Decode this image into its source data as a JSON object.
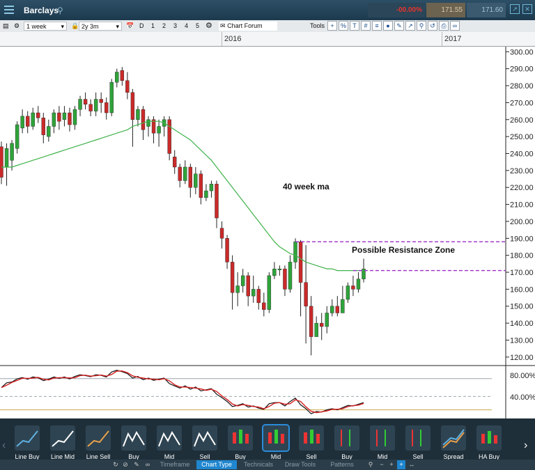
{
  "window": {
    "title": "Barclays",
    "change": "-00.00%",
    "sell_price": "171.55",
    "buy_price": "171.60"
  },
  "toolbar": {
    "interval": "1 week",
    "range": "2y 3m",
    "day_buttons": [
      "D",
      "1",
      "2",
      "3",
      "4",
      "5"
    ],
    "forum_label": "Chart Forum",
    "tools_label": "Tools",
    "tool_icons": [
      "crosshair-icon",
      "percent-icon",
      "text-icon",
      "grid-icon",
      "fibonacci-icon",
      "bulb-icon",
      "pencil-icon",
      "arrow-icon",
      "pin-icon",
      "loop-icon",
      "printer-icon",
      "link-icon"
    ]
  },
  "years": [
    "2016",
    "2017"
  ],
  "price_axis": [
    "300.00",
    "290.00",
    "280.00",
    "270.00",
    "260.00",
    "250.00",
    "240.00",
    "230.00",
    "220.00",
    "210.00",
    "200.00",
    "190.00",
    "180.00",
    "170.00",
    "160.00",
    "150.00",
    "140.00",
    "130.00",
    "120.00"
  ],
  "annotations": {
    "ma_label": "40 week ma",
    "resistance_label": "Possible Resistance Zone"
  },
  "indicator_axis": [
    "80.00%",
    "40.00%"
  ],
  "chart_data": {
    "type": "candlestick",
    "title": "",
    "ylim": [
      115,
      303
    ],
    "resistance_zone": [
      188,
      171
    ],
    "candles": [
      [
        244,
        226,
        247,
        222
      ],
      [
        232,
        243,
        246,
        221
      ],
      [
        236,
        246,
        248,
        230
      ],
      [
        243,
        257,
        259,
        240
      ],
      [
        255,
        262,
        266,
        252
      ],
      [
        262,
        256,
        265,
        252
      ],
      [
        256,
        264,
        267,
        254
      ],
      [
        264,
        261,
        268,
        258
      ],
      [
        261,
        251,
        264,
        246
      ],
      [
        250,
        256,
        260,
        247
      ],
      [
        256,
        264,
        266,
        252
      ],
      [
        264,
        259,
        268,
        254
      ],
      [
        260,
        264,
        268,
        256
      ],
      [
        264,
        257,
        267,
        253
      ],
      [
        257,
        266,
        268,
        254
      ],
      [
        266,
        272,
        274,
        262
      ],
      [
        272,
        269,
        276,
        266
      ],
      [
        269,
        265,
        272,
        262
      ],
      [
        265,
        272,
        276,
        262
      ],
      [
        272,
        270,
        276,
        264
      ],
      [
        270,
        264,
        273,
        260
      ],
      [
        264,
        282,
        284,
        262
      ],
      [
        282,
        288,
        290,
        279
      ],
      [
        289,
        283,
        291,
        280
      ],
      [
        283,
        276,
        288,
        272
      ],
      [
        276,
        260,
        278,
        244
      ],
      [
        260,
        266,
        268,
        256
      ],
      [
        266,
        254,
        268,
        248
      ],
      [
        256,
        260,
        262,
        250
      ],
      [
        260,
        252,
        262,
        246
      ],
      [
        252,
        256,
        260,
        244
      ],
      [
        256,
        260,
        262,
        250
      ],
      [
        260,
        240,
        262,
        236
      ],
      [
        238,
        232,
        242,
        228
      ],
      [
        232,
        224,
        234,
        220
      ],
      [
        224,
        232,
        236,
        222
      ],
      [
        232,
        220,
        234,
        214
      ],
      [
        220,
        228,
        232,
        216
      ],
      [
        228,
        214,
        230,
        210
      ],
      [
        214,
        218,
        222,
        212
      ],
      [
        218,
        222,
        224,
        214
      ],
      [
        222,
        202,
        224,
        196
      ],
      [
        196,
        190,
        200,
        184
      ],
      [
        190,
        176,
        192,
        172
      ],
      [
        176,
        158,
        180,
        148
      ],
      [
        158,
        162,
        170,
        150
      ],
      [
        162,
        168,
        172,
        158
      ],
      [
        168,
        156,
        170,
        150
      ],
      [
        156,
        160,
        168,
        152
      ],
      [
        160,
        152,
        162,
        148
      ],
      [
        152,
        148,
        158,
        144
      ],
      [
        148,
        168,
        170,
        146
      ],
      [
        168,
        172,
        176,
        166
      ],
      [
        172,
        172,
        174,
        168
      ],
      [
        172,
        160,
        174,
        156
      ],
      [
        160,
        176,
        180,
        158
      ],
      [
        176,
        188,
        190,
        172
      ],
      [
        188,
        164,
        189,
        144
      ],
      [
        164,
        150,
        186,
        128
      ],
      [
        150,
        132,
        156,
        121
      ],
      [
        132,
        140,
        144,
        134
      ],
      [
        140,
        138,
        146,
        130
      ],
      [
        138,
        146,
        150,
        134
      ],
      [
        146,
        150,
        154,
        144
      ],
      [
        150,
        146,
        156,
        144
      ],
      [
        146,
        154,
        162,
        146
      ],
      [
        154,
        162,
        164,
        152
      ],
      [
        162,
        160,
        168,
        156
      ],
      [
        160,
        166,
        170,
        158
      ],
      [
        166,
        172,
        178,
        164
      ]
    ],
    "ma": [
      232,
      232,
      232,
      233,
      234,
      235,
      236,
      237,
      238,
      239,
      240,
      241,
      242,
      243,
      244,
      245,
      246,
      247,
      248,
      249,
      250,
      251,
      252,
      253,
      254,
      256,
      257,
      258,
      259,
      259,
      259,
      258,
      256,
      254,
      252,
      250,
      248,
      245,
      242,
      239,
      236,
      232,
      228,
      224,
      220,
      216,
      212,
      208,
      204,
      200,
      196,
      192,
      188,
      185,
      183,
      181,
      180,
      178,
      176,
      175,
      174,
      173,
      172,
      172,
      171,
      171,
      171,
      171,
      171,
      171
    ]
  }
}
